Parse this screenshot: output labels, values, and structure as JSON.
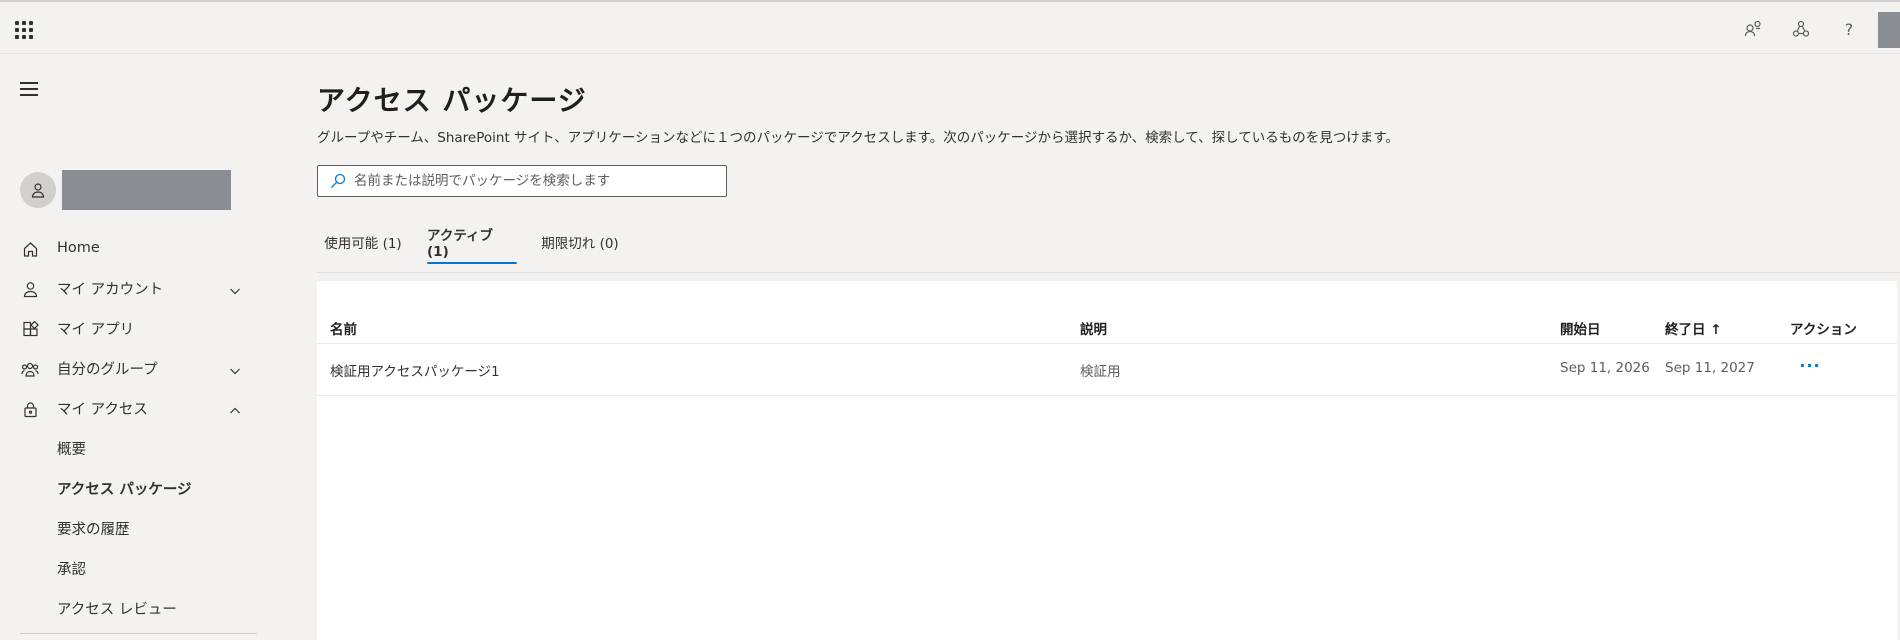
{
  "header": {
    "icons": [
      "app-launcher-icon",
      "feedback-icon",
      "organization-icon",
      "help-icon"
    ],
    "help_glyph": "?"
  },
  "sidebar": {
    "items": [
      {
        "label": "Home",
        "icon": "home-icon"
      },
      {
        "label": "マイ アカウント",
        "icon": "person-icon",
        "chevron": "down"
      },
      {
        "label": "マイ アプリ",
        "icon": "apps-icon"
      },
      {
        "label": "自分のグループ",
        "icon": "groups-icon",
        "chevron": "down"
      },
      {
        "label": "マイ アクセス",
        "icon": "lock-icon",
        "chevron": "up"
      }
    ],
    "sub_items": [
      {
        "label": "概要"
      },
      {
        "label": "アクセス パッケージ",
        "active": true
      },
      {
        "label": "要求の履歴"
      },
      {
        "label": "承認"
      },
      {
        "label": "アクセス レビュー"
      }
    ]
  },
  "main": {
    "title": "アクセス パッケージ",
    "description": "グループやチーム、SharePoint サイト、アプリケーションなどに１つのパッケージでアクセスします。次のパッケージから選択するか、検索して、探しているものを見つけます。",
    "search": {
      "placeholder": "名前または説明でパッケージを検索します",
      "value": ""
    },
    "tabs": [
      {
        "label": "使用可能 (1)"
      },
      {
        "label": "アクティブ (1)",
        "active": true
      },
      {
        "label": "期限切れ (0)"
      }
    ],
    "table": {
      "columns": [
        "名前",
        "説明",
        "開始日",
        "終了日 ↑",
        "アクション"
      ],
      "rows": [
        {
          "name": "検証用アクセスパッケージ1",
          "description": "検証用",
          "start": "Sep 11, 2026",
          "end": "Sep 11, 2027",
          "action": "···"
        }
      ]
    }
  },
  "colors": {
    "accent": "#0078d4",
    "background": "#f3f2f1",
    "text": "#323130"
  }
}
